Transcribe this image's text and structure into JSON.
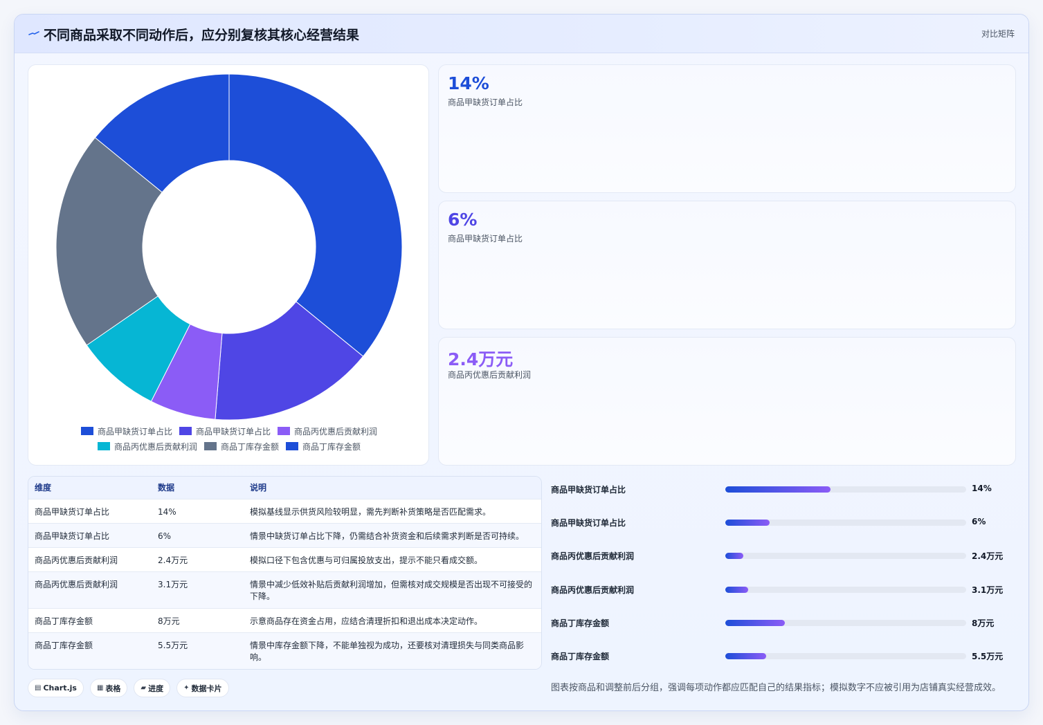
{
  "header": {
    "title": "不同商品采取不同动作后，应分别复核其核心经营结果",
    "tag": "对比矩阵"
  },
  "kpis": [
    {
      "value": "14%",
      "label": "商品甲缺货订单占比",
      "color": "#1d4ed8"
    },
    {
      "value": "6%",
      "label": "商品甲缺货订单占比",
      "color": "#4f46e5"
    },
    {
      "value": "2.4万元",
      "label": "商品丙优惠后贡献利润",
      "color": "#8b5cf6"
    }
  ],
  "chart_data": {
    "type": "pie",
    "donut": true,
    "categories": [
      "商品甲缺货订单占比",
      "商品甲缺货订单占比",
      "商品丙优惠后贡献利润",
      "商品丙优惠后贡献利润",
      "商品丁库存金额",
      "商品丁库存金额"
    ],
    "values": [
      14,
      6,
      2.4,
      3.1,
      8,
      5.5
    ],
    "colors": [
      "#1d4ed8",
      "#4f46e5",
      "#8b5cf6",
      "#06b6d4",
      "#64748b",
      "#1d4ed8"
    ],
    "legend_position": "bottom",
    "start_angle": "top"
  },
  "table": {
    "headers": [
      "维度",
      "数据",
      "说明"
    ],
    "rows": [
      [
        "商品甲缺货订单占比",
        "14%",
        "模拟基线显示供货风险较明显，需先判断补货策略是否匹配需求。"
      ],
      [
        "商品甲缺货订单占比",
        "6%",
        "情景中缺货订单占比下降，仍需结合补货资金和后续需求判断是否可持续。"
      ],
      [
        "商品丙优惠后贡献利润",
        "2.4万元",
        "模拟口径下包含优惠与可归属投放支出，提示不能只看成交额。"
      ],
      [
        "商品丙优惠后贡献利润",
        "3.1万元",
        "情景中减少低效补贴后贡献利润增加，但需核对成交规模是否出现不可接受的下降。"
      ],
      [
        "商品丁库存金额",
        "8万元",
        "示意商品存在资金占用，应结合清理折扣和退出成本决定动作。"
      ],
      [
        "商品丁库存金额",
        "5.5万元",
        "情景中库存金额下降，不能单独视为成功，还要核对清理损失与同类商品影响。"
      ]
    ]
  },
  "progress": [
    {
      "label": "商品甲缺货订单占比",
      "value": "14%",
      "fraction": 0.436
    },
    {
      "label": "商品甲缺货订单占比",
      "value": "6%",
      "fraction": 0.184
    },
    {
      "label": "商品丙优惠后贡献利润",
      "value": "2.4万元",
      "fraction": 0.075
    },
    {
      "label": "商品丙优惠后贡献利润",
      "value": "3.1万元",
      "fraction": 0.095
    },
    {
      "label": "商品丁库存金额",
      "value": "8万元",
      "fraction": 0.247
    },
    {
      "label": "商品丁库存金额",
      "value": "5.5万元",
      "fraction": 0.17
    }
  ],
  "footnote": "图表按商品和调整前后分组，强调每项动作都应匹配自己的结果指标；模拟数字不应被引用为店铺真实经营成效。",
  "chips": [
    {
      "icon": "▤",
      "icon_name": "chart-icon",
      "label": "Chart.js"
    },
    {
      "icon": "▦",
      "icon_name": "table-icon",
      "label": "表格"
    },
    {
      "icon": "▰",
      "icon_name": "progress-icon",
      "label": "进度"
    },
    {
      "icon": "✦",
      "icon_name": "sparkle-icon",
      "label": "数据卡片"
    }
  ]
}
